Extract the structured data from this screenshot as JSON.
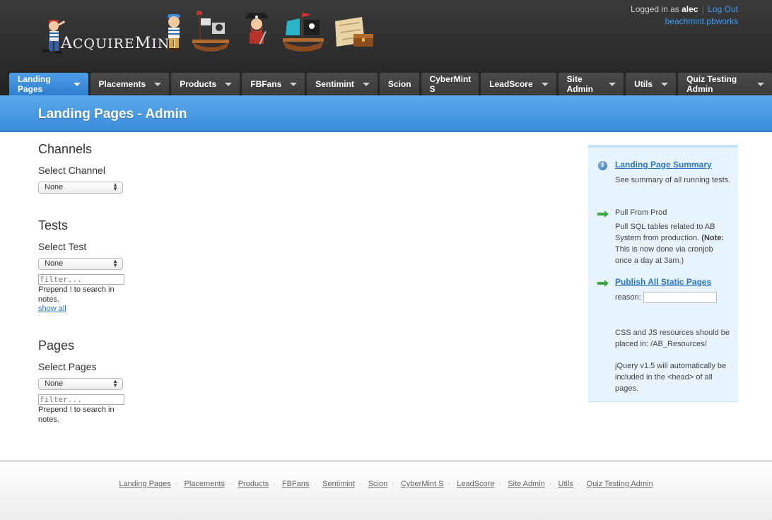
{
  "app": {
    "logo_text_first": "A",
    "logo_text_rest": "CQUIRE",
    "logo_text_m": "M",
    "logo_text_end": "INT"
  },
  "user": {
    "logged_in_prefix": "Logged in as",
    "username": "alec",
    "logout_label": "Log Out",
    "site_link": "beachmint.pbworks"
  },
  "nav": {
    "items": [
      {
        "label": "Landing Pages",
        "active": true
      },
      {
        "label": "Placements"
      },
      {
        "label": "Products"
      },
      {
        "label": "FBFans"
      },
      {
        "label": "Sentimint"
      },
      {
        "label": "Scion"
      },
      {
        "label": "CyberMint S"
      },
      {
        "label": "LeadScore"
      },
      {
        "label": "Site Admin"
      },
      {
        "label": "Utils"
      },
      {
        "label": "Quiz Testing Admin"
      }
    ]
  },
  "page": {
    "title": "Landing Pages - Admin"
  },
  "channels": {
    "heading": "Channels",
    "label": "Select Channel",
    "selected": "None"
  },
  "tests": {
    "heading": "Tests",
    "label": "Select Test",
    "selected": "None",
    "filter_placeholder": "filter...",
    "hint": "Prepend ! to search in notes.",
    "show_all": "show all"
  },
  "pages": {
    "heading": "Pages",
    "label": "Select Pages",
    "selected": "None",
    "filter_placeholder": "filter...",
    "hint": "Prepend ! to search in notes."
  },
  "sidebar": {
    "summary_link": "Landing Page Summary",
    "summary_desc": "See summary of all running tests.",
    "pull_title": "Pull From Prod",
    "pull_desc": "Pull SQL tables related to AB System from production.",
    "pull_note_label": "(Note:",
    "pull_note_text": "This is now done via cronjob once a day at 3am.)",
    "publish_link": "Publish All Static Pages",
    "reason_label": "reason:",
    "resources_note": "CSS and JS resources should be placed in: /AB_Resources/",
    "jquery_note": "jQuery v1.5 will automatically be included in the <head> of all pages."
  },
  "footer": {
    "links": [
      "Landing Pages",
      "Placements",
      "Products",
      "FBFans",
      "Sentimint",
      "Scion",
      "CyberMint S",
      "LeadScore",
      "Site Admin",
      "Utils",
      "Quiz Testing Admin"
    ],
    "separator": "·"
  },
  "colors": {
    "accent": "#3a8ddc",
    "link": "#2a78c2",
    "header_bg": "#2b2b2b",
    "panel_bg": "#e7f3fd"
  }
}
